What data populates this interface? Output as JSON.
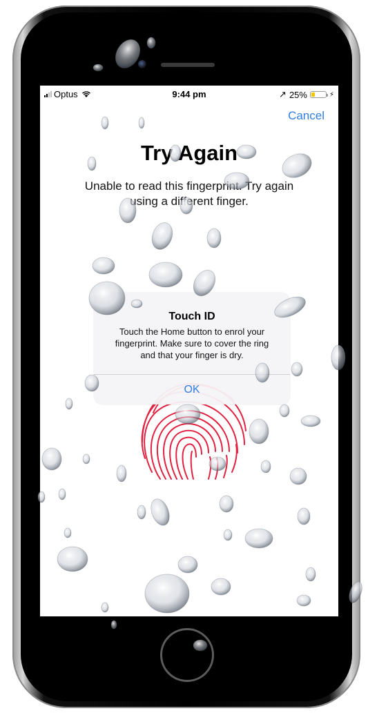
{
  "status_bar": {
    "carrier": "Optus",
    "time": "9:44 pm",
    "location_glyph": "↗",
    "battery_percent": "25%",
    "battery_level": 0.25,
    "charging_glyph": "⚡"
  },
  "nav": {
    "cancel_label": "Cancel"
  },
  "main": {
    "title": "Try Again",
    "subtitle_line1": "Unable to read this fingerprint. Try again",
    "subtitle_line2": "using a different finger."
  },
  "alert": {
    "title": "Touch ID",
    "message_line1": "Touch the Home button to enrol your",
    "message_line2": "fingerprint. Make sure to cover the ring",
    "message_line3": "and that your finger is dry.",
    "ok_label": "OK"
  },
  "colors": {
    "accent": "#2f7de1",
    "fingerprint": "#e0213f",
    "battery": "#f6c700"
  },
  "icons": [
    "signal-icon",
    "wifi-icon",
    "location-icon",
    "battery-icon",
    "charging-icon",
    "fingerprint-icon",
    "water-drop-icon"
  ]
}
